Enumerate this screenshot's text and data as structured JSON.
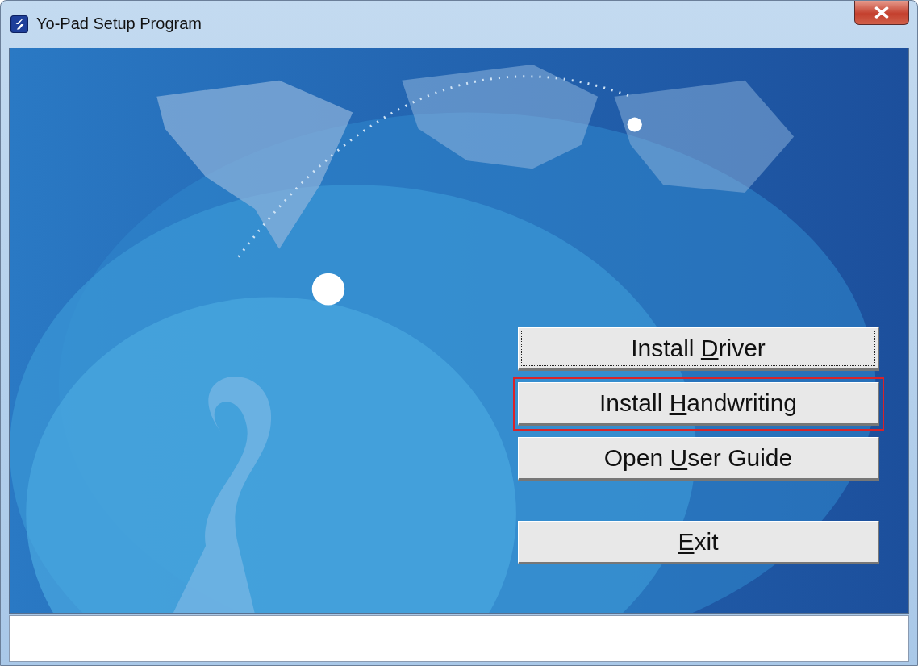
{
  "window": {
    "title": "Yo-Pad Setup Program"
  },
  "buttons": [
    {
      "before": "Install ",
      "key": "D",
      "after": "river",
      "focused": true,
      "highlighted": false
    },
    {
      "before": "Install ",
      "key": "H",
      "after": "andwriting",
      "focused": false,
      "highlighted": true
    },
    {
      "before": "Open ",
      "key": "U",
      "after": "ser Guide",
      "focused": false,
      "highlighted": false
    }
  ],
  "exit_button": {
    "key": "E",
    "after": "xit",
    "focused": false,
    "highlighted": false
  }
}
